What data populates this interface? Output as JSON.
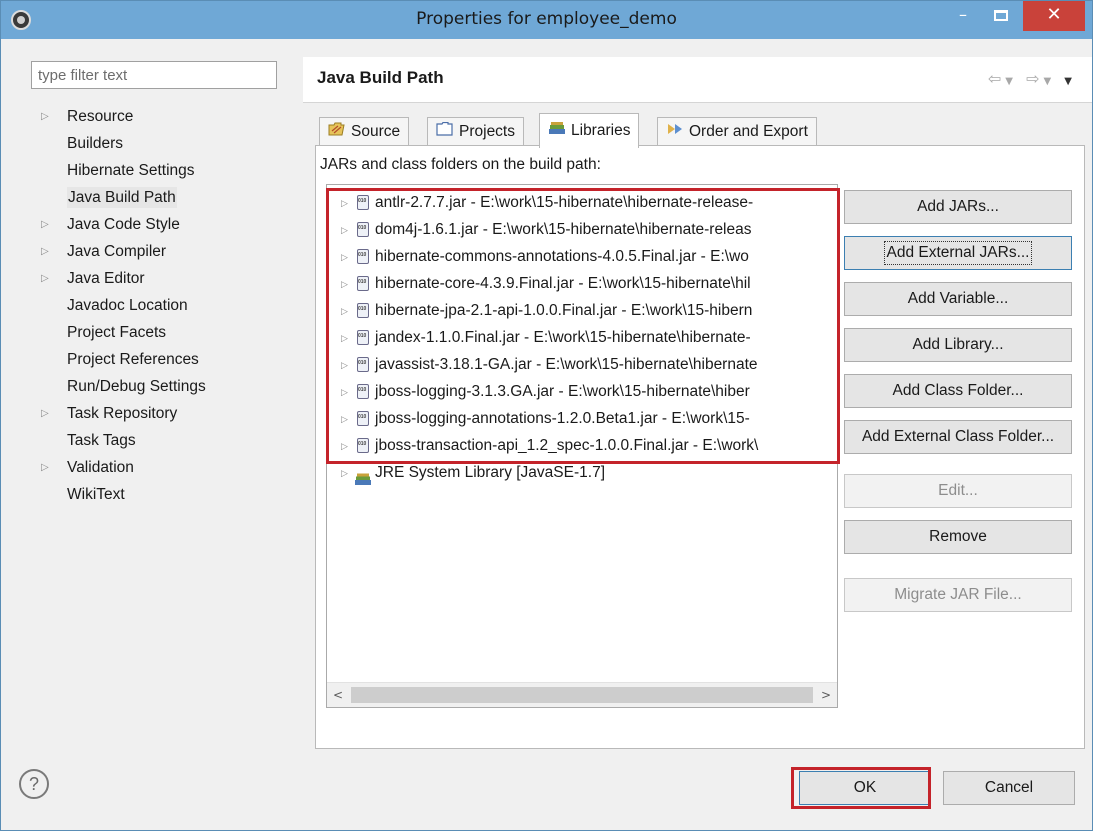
{
  "window": {
    "title": "Properties for employee_demo",
    "minimize_glyph": "–",
    "close_glyph": "✕"
  },
  "filter": {
    "placeholder": "type filter text"
  },
  "tree": [
    {
      "label": "Resource",
      "expandable": true
    },
    {
      "label": "Builders",
      "expandable": false
    },
    {
      "label": "Hibernate Settings",
      "expandable": false
    },
    {
      "label": "Java Build Path",
      "expandable": false,
      "selected": true
    },
    {
      "label": "Java Code Style",
      "expandable": true
    },
    {
      "label": "Java Compiler",
      "expandable": true
    },
    {
      "label": "Java Editor",
      "expandable": true
    },
    {
      "label": "Javadoc Location",
      "expandable": false
    },
    {
      "label": "Project Facets",
      "expandable": false
    },
    {
      "label": "Project References",
      "expandable": false
    },
    {
      "label": "Run/Debug Settings",
      "expandable": false
    },
    {
      "label": "Task Repository",
      "expandable": true
    },
    {
      "label": "Task Tags",
      "expandable": false
    },
    {
      "label": "Validation",
      "expandable": true
    },
    {
      "label": "WikiText",
      "expandable": false
    }
  ],
  "page": {
    "title": "Java Build Path",
    "tabs": [
      {
        "label": "Source",
        "icon": "source-folder-icon"
      },
      {
        "label": "Projects",
        "icon": "projects-folder-icon"
      },
      {
        "label": "Libraries",
        "icon": "libraries-icon",
        "active": true
      },
      {
        "label": "Order and Export",
        "icon": "order-export-icon"
      }
    ],
    "list_label": "JARs and class folders on the build path:",
    "entries": [
      "antlr-2.7.7.jar - E:\\work\\15-hibernate\\hibernate-release-",
      "dom4j-1.6.1.jar - E:\\work\\15-hibernate\\hibernate-releas",
      "hibernate-commons-annotations-4.0.5.Final.jar - E:\\wo",
      "hibernate-core-4.3.9.Final.jar - E:\\work\\15-hibernate\\hil",
      "hibernate-jpa-2.1-api-1.0.0.Final.jar - E:\\work\\15-hibern",
      "jandex-1.1.0.Final.jar - E:\\work\\15-hibernate\\hibernate-",
      "javassist-3.18.1-GA.jar - E:\\work\\15-hibernate\\hibernate",
      "jboss-logging-3.1.3.GA.jar - E:\\work\\15-hibernate\\hiber",
      "jboss-logging-annotations-1.2.0.Beta1.jar - E:\\work\\15-",
      "jboss-transaction-api_1.2_spec-1.0.0.Final.jar - E:\\work\\"
    ],
    "jre_entry": "JRE System Library [JavaSE-1.7]",
    "buttons": {
      "add_jars": "Add JARs...",
      "add_external_jars": "Add External JARs...",
      "add_variable": "Add Variable...",
      "add_library": "Add Library...",
      "add_class_folder": "Add Class Folder...",
      "add_external_class_folder": "Add External Class Folder...",
      "edit": "Edit...",
      "remove": "Remove",
      "migrate_jar": "Migrate JAR File..."
    }
  },
  "footer": {
    "help": "?",
    "ok": "OK",
    "cancel": "Cancel"
  },
  "colors": {
    "titlebar": "#6fa8d6",
    "close_button": "#c9423a",
    "highlight": "#c4232a"
  }
}
